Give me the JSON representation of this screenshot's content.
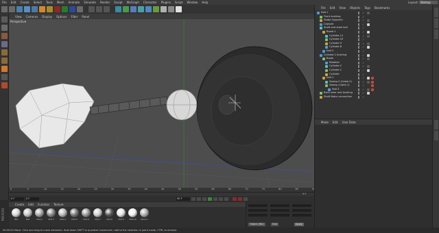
{
  "menubar": {
    "items": [
      "File",
      "Edit",
      "Create",
      "Select",
      "Tools",
      "Mesh",
      "Animate",
      "Simulate",
      "Render",
      "Sculpt",
      "MoGraph",
      "Character",
      "Plugins",
      "Script",
      "Window",
      "Help"
    ],
    "layout_label": "Layout:",
    "layout_value": "Startup"
  },
  "viewport": {
    "menu": [
      "View",
      "Cameras",
      "Display",
      "Options",
      "Filter",
      "Panel"
    ],
    "label": "Perspective"
  },
  "timeline": {
    "ticks": [
      "0",
      "5",
      "10",
      "15",
      "20",
      "25",
      "30",
      "35",
      "40",
      "45",
      "50",
      "55",
      "60",
      "65",
      "70",
      "75",
      "80",
      "85",
      "90"
    ],
    "end_label": "0 F",
    "start_field": "0 F",
    "current_field": "0 F",
    "end_field": "90 F",
    "max_field": "90 F"
  },
  "materials": {
    "menu": [
      "Create",
      "Edit",
      "Function",
      "Texture"
    ],
    "items": [
      {
        "label": "Mat",
        "color": "#d8d8d8"
      },
      {
        "label": "Mat",
        "color": "#c4c4c4"
      },
      {
        "label": "Mat.2",
        "color": "#a8a8a8"
      },
      {
        "label": "Mat.3",
        "color": "#8c8c8c"
      },
      {
        "label": "Mat.4",
        "color": "#b8b8b8"
      },
      {
        "label": "Mat.5",
        "color": "#7a7a7a"
      },
      {
        "label": "Mat.6",
        "color": "#9a9a9a"
      },
      {
        "label": "Mat.7",
        "color": "#cfcfcf"
      },
      {
        "label": "Mat.8",
        "color": "#5a5a5a"
      },
      {
        "label": "Mat.9",
        "color": "#e6e6e6"
      },
      {
        "label": "Mat.10",
        "color": "#f0f0f0"
      },
      {
        "label": "Mat.11",
        "color": "#b0b0b0"
      }
    ]
  },
  "coords": {
    "mode": "Object (Rel)",
    "size": "Size",
    "apply": "Apply"
  },
  "status": {
    "text": "00:00:00  Move: Click and drag to move elements. Hold down SHIFT to quantize movement / add to the selection in point mode, CTRL to remove."
  },
  "object_manager": {
    "menu": [
      "File",
      "Edit",
      "View",
      "Objects",
      "Tags",
      "Bookmarks"
    ],
    "rows": [
      {
        "indent": 0,
        "name": "Null.1"
      },
      {
        "indent": 1,
        "name": "Front bushing"
      },
      {
        "indent": 1,
        "name": "Stabo Supports"
      },
      {
        "indent": 1,
        "name": "Capsule"
      },
      {
        "indent": 1,
        "name": "Shaft and steel ball"
      },
      {
        "indent": 2,
        "name": "Boole.1"
      },
      {
        "indent": 3,
        "name": "Cylinder.11"
      },
      {
        "indent": 3,
        "name": "Cylinder.10"
      },
      {
        "indent": 3,
        "name": "Cylinder.9"
      },
      {
        "indent": 3,
        "name": "Cylinder.8"
      },
      {
        "indent": 2,
        "name": "Null.2"
      },
      {
        "indent": 1,
        "name": "Cylinder.1 bushing"
      },
      {
        "indent": 2,
        "name": "Boole"
      },
      {
        "indent": 3,
        "name": "Rotation"
      },
      {
        "indent": 3,
        "name": "Cylinder.2"
      },
      {
        "indent": 3,
        "name": "Cylinder.1"
      },
      {
        "indent": 3,
        "name": "Cylinder"
      },
      {
        "indent": 2,
        "name": "Null.1"
      },
      {
        "indent": 3,
        "name": "Sweep.0 (Cable.2)"
      },
      {
        "indent": 3,
        "name": "Sweep (Cable.1)"
      },
      {
        "indent": 4,
        "name": "Null.3"
      },
      {
        "indent": 1,
        "name": "Back rotor and bushing"
      },
      {
        "indent": 1,
        "name": "Shaft Rotor connection"
      }
    ]
  },
  "attributes": {
    "menu": [
      "Mode",
      "Edit",
      "User Data"
    ]
  }
}
